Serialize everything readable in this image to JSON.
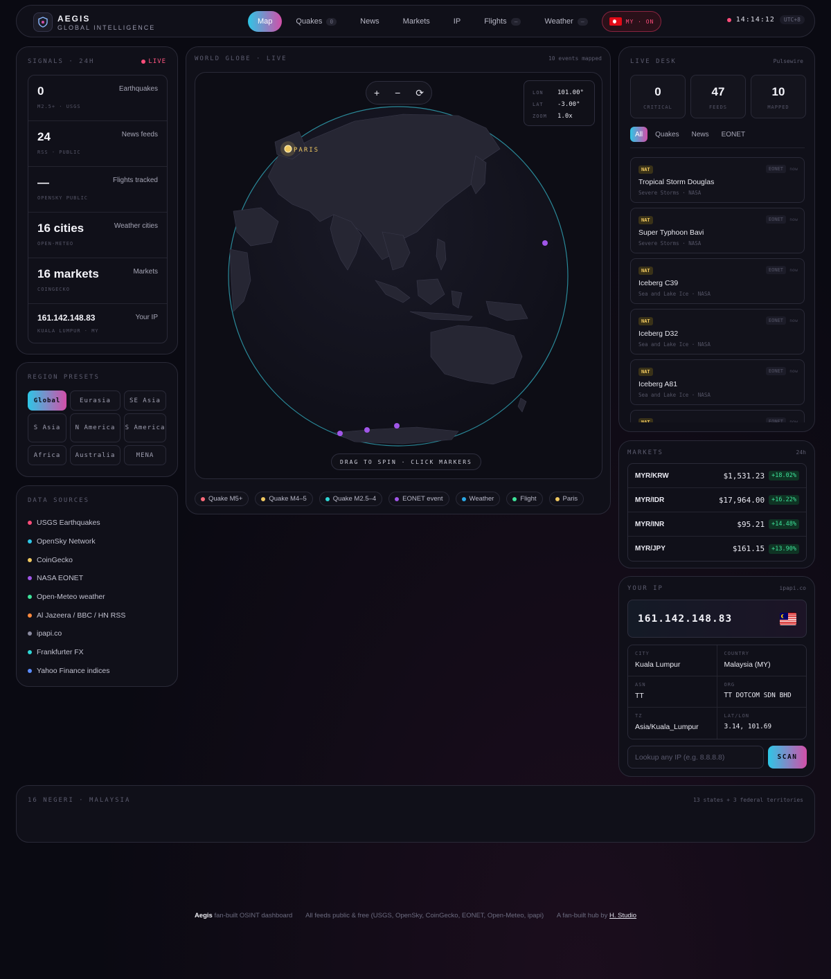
{
  "brand": {
    "name": "AEGIS",
    "tagline": "GLOBAL INTELLIGENCE"
  },
  "nav": {
    "items": [
      {
        "label": "Map",
        "badge": "",
        "active": true
      },
      {
        "label": "Quakes",
        "badge": "0"
      },
      {
        "label": "News",
        "badge": ""
      },
      {
        "label": "Markets",
        "badge": ""
      },
      {
        "label": "IP",
        "badge": ""
      },
      {
        "label": "Flights",
        "badge": "—"
      },
      {
        "label": "Weather",
        "badge": "—"
      }
    ],
    "location": "MY · ON"
  },
  "clock": {
    "time": "14:14:12",
    "tz": "UTC+8"
  },
  "signals": {
    "label": "SIGNALS · 24H",
    "live": "LIVE",
    "rows": [
      {
        "value": "0",
        "label": "Earthquakes",
        "sub": "M2.5+ · USGS"
      },
      {
        "value": "24",
        "label": "News feeds",
        "sub": "RSS · PUBLIC"
      },
      {
        "value": "—",
        "label": "Flights tracked",
        "sub": "OPENSKY PUBLIC"
      },
      {
        "value": "16 cities",
        "label": "Weather cities",
        "sub": "OPEN-METEO"
      },
      {
        "value": "16 markets",
        "label": "Markets",
        "sub": "COINGECKO"
      },
      {
        "value": "161.142.148.83",
        "label": "Your IP",
        "sub": "KUALA LUMPUR · MY"
      }
    ]
  },
  "regions": {
    "label": "REGION PRESETS",
    "items": [
      "Global",
      "Eurasia",
      "SE Asia",
      "S Asia",
      "N America",
      "S America",
      "Africa",
      "Australia",
      "MENA"
    ]
  },
  "sources": {
    "label": "DATA SOURCES",
    "items": [
      {
        "name": "USGS Earthquakes",
        "color": "#ff4d7a"
      },
      {
        "name": "OpenSky Network",
        "color": "#2ec6e6"
      },
      {
        "name": "CoinGecko",
        "color": "#f0c860"
      },
      {
        "name": "NASA EONET",
        "color": "#a056e8"
      },
      {
        "name": "Open-Meteo weather",
        "color": "#3ee39a"
      },
      {
        "name": "Al Jazeera / BBC / HN RSS",
        "color": "#ff8a3d"
      },
      {
        "name": "ipapi.co",
        "color": "#8a8aa0"
      },
      {
        "name": "Frankfurter FX",
        "color": "#2ed6d6"
      },
      {
        "name": "Yahoo Finance indices",
        "color": "#5a8cff"
      }
    ]
  },
  "globe": {
    "label": "WORLD GLOBE · LIVE",
    "count": "10 events mapped",
    "zoom_in": "+",
    "zoom_out": "−",
    "reset": "⟳",
    "lon_label": "LON",
    "lon": "101.00°",
    "lat_label": "LAT",
    "lat": "-3.00°",
    "zoom_label": "ZOOM",
    "zoom": "1.0x",
    "paris_label": "PARIS",
    "hint": "DRAG TO SPIN · CLICK MARKERS",
    "legend": [
      {
        "label": "Quake M5+",
        "color": "#ff6b7a"
      },
      {
        "label": "Quake M4–5",
        "color": "#f0c860"
      },
      {
        "label": "Quake M2.5–4",
        "color": "#2ed6d6"
      },
      {
        "label": "EONET event",
        "color": "#a056e8"
      },
      {
        "label": "Weather",
        "color": "#2aa8e6"
      },
      {
        "label": "Flight",
        "color": "#3ee39a"
      },
      {
        "label": "Paris",
        "color": "#f0c860"
      }
    ]
  },
  "livedesk": {
    "label": "LIVE DESK",
    "source": "Pulsewire",
    "stats": [
      {
        "value": "0",
        "label": "CRITICAL"
      },
      {
        "value": "47",
        "label": "FEEDS"
      },
      {
        "value": "10",
        "label": "MAPPED"
      }
    ],
    "filters": [
      "All",
      "Quakes",
      "News",
      "EONET"
    ],
    "events": [
      {
        "tag": "NAT",
        "src": "EONET",
        "time": "now",
        "title": "Tropical Storm Douglas",
        "sub": "Severe Storms · NASA"
      },
      {
        "tag": "NAT",
        "src": "EONET",
        "time": "now",
        "title": "Super Typhoon Bavi",
        "sub": "Severe Storms · NASA"
      },
      {
        "tag": "NAT",
        "src": "EONET",
        "time": "now",
        "title": "Iceberg C39",
        "sub": "Sea and Lake Ice · NASA"
      },
      {
        "tag": "NAT",
        "src": "EONET",
        "time": "now",
        "title": "Iceberg D32",
        "sub": "Sea and Lake Ice · NASA"
      },
      {
        "tag": "NAT",
        "src": "EONET",
        "time": "now",
        "title": "Iceberg A81",
        "sub": "Sea and Lake Ice · NASA"
      },
      {
        "tag": "NAT",
        "src": "EONET",
        "time": "now",
        "title": "",
        "sub": ""
      }
    ]
  },
  "markets": {
    "label": "MARKETS",
    "range": "24h",
    "rows": [
      {
        "pair": "MYR/KRW",
        "price": "$1,531.23",
        "change": "+18.02%"
      },
      {
        "pair": "MYR/IDR",
        "price": "$17,964.00",
        "change": "+16.22%"
      },
      {
        "pair": "MYR/INR",
        "price": "$95.21",
        "change": "+14.48%"
      },
      {
        "pair": "MYR/JPY",
        "price": "$161.15",
        "change": "+13.90%"
      }
    ]
  },
  "yourip": {
    "label": "YOUR IP",
    "source": "ipapi.co",
    "ip": "161.142.148.83",
    "city_k": "CITY",
    "city": "Kuala Lumpur",
    "country_k": "COUNTRY",
    "country": "Malaysia (MY)",
    "asn_k": "ASN",
    "asn": "TT",
    "org_k": "ORG",
    "org": "TT DOTCOM SDN BHD",
    "tz_k": "TZ",
    "tz": "Asia/Kuala_Lumpur",
    "latlon_k": "LAT/LON",
    "latlon": "3.14, 101.69",
    "lookup_placeholder": "Lookup any IP (e.g. 8.8.8.8)",
    "scan": "SCAN"
  },
  "negeri": {
    "label": "16 NEGERI · MALAYSIA",
    "summary": "13 states + 3 federal territories"
  },
  "footer": {
    "brand": "Aegis",
    "desc": "fan-built OSINT dashboard",
    "feeds": "All feeds public & free (USGS, OpenSky, CoinGecko, EONET, Open-Meteo, ipapi)",
    "credit": "A fan-built hub by",
    "studio": "H. Studio"
  }
}
